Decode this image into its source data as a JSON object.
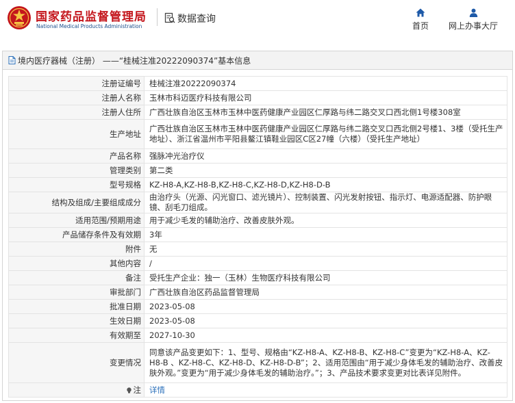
{
  "header": {
    "org_name_cn": "国家药品监督管理局",
    "org_name_en": "National Medical Products Administration",
    "query_title": "数据查询",
    "nav_home": "首页",
    "nav_hall": "网上办事大厅"
  },
  "title_bar": {
    "text": "境内医疗器械（注册） ——“桂械注准20222090374”基本信息"
  },
  "records": [
    {
      "label": "注册证编号",
      "value": "桂械注准20222090374"
    },
    {
      "label": "注册人名称",
      "value": "玉林市科迈医疗科技有限公司"
    },
    {
      "label": "注册人住所",
      "value": "广西壮族自治区玉林市玉林中医药健康产业园区仁厚路与纬二路交叉口西北侧1号楼308室"
    },
    {
      "label": "生产地址",
      "value": "广西壮族自治区玉林市玉林中医药健康产业园区仁厚路与纬二路交叉口西北侧2号楼1、3楼（受托生产地址）、浙江省温州市平阳县鳌江镇鞋业园区C区27幢（六楼）（受托生产地址）"
    },
    {
      "label": "产品名称",
      "value": "强脉冲光治疗仪"
    },
    {
      "label": "管理类别",
      "value": "第二类"
    },
    {
      "label": "型号规格",
      "value": "KZ-H8-A,KZ-H8-B,KZ-H8-C,KZ-H8-D,KZ-H8-D-B"
    },
    {
      "label": "结构及组成/主要组成成分",
      "value": "由治疗头（光源、闪光窗口、滤光镜片）、控制装置、闪光发射按钮、指示灯、电源适配器、防护眼镜、刮毛刀组成。"
    },
    {
      "label": "适用范围/预期用途",
      "value": "用于减少毛发的辅助治疗、改善皮肤外观。"
    },
    {
      "label": "产品储存条件及有效期",
      "value": "3年"
    },
    {
      "label": "附件",
      "value": "无"
    },
    {
      "label": "其他内容",
      "value": "/"
    },
    {
      "label": "备注",
      "value": "受托生产企业：独一（玉林）生物医疗科技有限公司"
    },
    {
      "label": "审批部门",
      "value": "广西壮族自治区药品监督管理局"
    },
    {
      "label": "批准日期",
      "value": "2023-05-08"
    },
    {
      "label": "生效日期",
      "value": "2023-05-08"
    },
    {
      "label": "有效期至",
      "value": "2027-10-30"
    },
    {
      "label": "变更情况",
      "value": "同意该产品变更如下：1、型号、规格由“KZ-H8-A、KZ-H8-B、KZ-H8-C”变更为“KZ-H8-A、KZ-H8-B 、KZ-H8-C、KZ-H8-D、KZ-H8-D-B”；2、适用范围由“用于减少身体毛发的辅助治疗、改善皮肤外观。”变更为“用于减少身体毛发的辅助治疗。”；3、产品技术要求变更对比表详见附件。"
    },
    {
      "label": "注",
      "value": "详情"
    }
  ],
  "colors": {
    "brand_red": "#c4161c",
    "brand_blue": "#1a4d8c",
    "link_blue": "#2a6fba",
    "nav_icon": "#1e5aa8"
  },
  "icons": {
    "logo": "national-emblem-logo",
    "query": "search-document-icon",
    "home": "home-icon",
    "hall": "user-icon",
    "title": "document-icon",
    "note": "lightbulb-icon"
  }
}
